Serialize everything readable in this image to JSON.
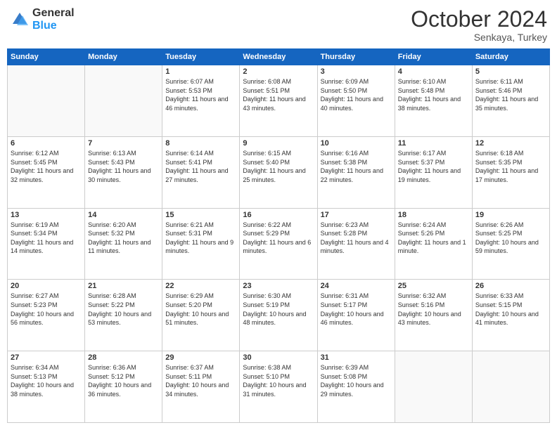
{
  "logo": {
    "general": "General",
    "blue": "Blue"
  },
  "header": {
    "month": "October 2024",
    "location": "Senkaya, Turkey"
  },
  "weekdays": [
    "Sunday",
    "Monday",
    "Tuesday",
    "Wednesday",
    "Thursday",
    "Friday",
    "Saturday"
  ],
  "weeks": [
    [
      {
        "day": "",
        "empty": true
      },
      {
        "day": "",
        "empty": true
      },
      {
        "day": "1",
        "sunrise": "Sunrise: 6:07 AM",
        "sunset": "Sunset: 5:53 PM",
        "daylight": "Daylight: 11 hours and 46 minutes."
      },
      {
        "day": "2",
        "sunrise": "Sunrise: 6:08 AM",
        "sunset": "Sunset: 5:51 PM",
        "daylight": "Daylight: 11 hours and 43 minutes."
      },
      {
        "day": "3",
        "sunrise": "Sunrise: 6:09 AM",
        "sunset": "Sunset: 5:50 PM",
        "daylight": "Daylight: 11 hours and 40 minutes."
      },
      {
        "day": "4",
        "sunrise": "Sunrise: 6:10 AM",
        "sunset": "Sunset: 5:48 PM",
        "daylight": "Daylight: 11 hours and 38 minutes."
      },
      {
        "day": "5",
        "sunrise": "Sunrise: 6:11 AM",
        "sunset": "Sunset: 5:46 PM",
        "daylight": "Daylight: 11 hours and 35 minutes."
      }
    ],
    [
      {
        "day": "6",
        "sunrise": "Sunrise: 6:12 AM",
        "sunset": "Sunset: 5:45 PM",
        "daylight": "Daylight: 11 hours and 32 minutes."
      },
      {
        "day": "7",
        "sunrise": "Sunrise: 6:13 AM",
        "sunset": "Sunset: 5:43 PM",
        "daylight": "Daylight: 11 hours and 30 minutes."
      },
      {
        "day": "8",
        "sunrise": "Sunrise: 6:14 AM",
        "sunset": "Sunset: 5:41 PM",
        "daylight": "Daylight: 11 hours and 27 minutes."
      },
      {
        "day": "9",
        "sunrise": "Sunrise: 6:15 AM",
        "sunset": "Sunset: 5:40 PM",
        "daylight": "Daylight: 11 hours and 25 minutes."
      },
      {
        "day": "10",
        "sunrise": "Sunrise: 6:16 AM",
        "sunset": "Sunset: 5:38 PM",
        "daylight": "Daylight: 11 hours and 22 minutes."
      },
      {
        "day": "11",
        "sunrise": "Sunrise: 6:17 AM",
        "sunset": "Sunset: 5:37 PM",
        "daylight": "Daylight: 11 hours and 19 minutes."
      },
      {
        "day": "12",
        "sunrise": "Sunrise: 6:18 AM",
        "sunset": "Sunset: 5:35 PM",
        "daylight": "Daylight: 11 hours and 17 minutes."
      }
    ],
    [
      {
        "day": "13",
        "sunrise": "Sunrise: 6:19 AM",
        "sunset": "Sunset: 5:34 PM",
        "daylight": "Daylight: 11 hours and 14 minutes."
      },
      {
        "day": "14",
        "sunrise": "Sunrise: 6:20 AM",
        "sunset": "Sunset: 5:32 PM",
        "daylight": "Daylight: 11 hours and 11 minutes."
      },
      {
        "day": "15",
        "sunrise": "Sunrise: 6:21 AM",
        "sunset": "Sunset: 5:31 PM",
        "daylight": "Daylight: 11 hours and 9 minutes."
      },
      {
        "day": "16",
        "sunrise": "Sunrise: 6:22 AM",
        "sunset": "Sunset: 5:29 PM",
        "daylight": "Daylight: 11 hours and 6 minutes."
      },
      {
        "day": "17",
        "sunrise": "Sunrise: 6:23 AM",
        "sunset": "Sunset: 5:28 PM",
        "daylight": "Daylight: 11 hours and 4 minutes."
      },
      {
        "day": "18",
        "sunrise": "Sunrise: 6:24 AM",
        "sunset": "Sunset: 5:26 PM",
        "daylight": "Daylight: 11 hours and 1 minute."
      },
      {
        "day": "19",
        "sunrise": "Sunrise: 6:26 AM",
        "sunset": "Sunset: 5:25 PM",
        "daylight": "Daylight: 10 hours and 59 minutes."
      }
    ],
    [
      {
        "day": "20",
        "sunrise": "Sunrise: 6:27 AM",
        "sunset": "Sunset: 5:23 PM",
        "daylight": "Daylight: 10 hours and 56 minutes."
      },
      {
        "day": "21",
        "sunrise": "Sunrise: 6:28 AM",
        "sunset": "Sunset: 5:22 PM",
        "daylight": "Daylight: 10 hours and 53 minutes."
      },
      {
        "day": "22",
        "sunrise": "Sunrise: 6:29 AM",
        "sunset": "Sunset: 5:20 PM",
        "daylight": "Daylight: 10 hours and 51 minutes."
      },
      {
        "day": "23",
        "sunrise": "Sunrise: 6:30 AM",
        "sunset": "Sunset: 5:19 PM",
        "daylight": "Daylight: 10 hours and 48 minutes."
      },
      {
        "day": "24",
        "sunrise": "Sunrise: 6:31 AM",
        "sunset": "Sunset: 5:17 PM",
        "daylight": "Daylight: 10 hours and 46 minutes."
      },
      {
        "day": "25",
        "sunrise": "Sunrise: 6:32 AM",
        "sunset": "Sunset: 5:16 PM",
        "daylight": "Daylight: 10 hours and 43 minutes."
      },
      {
        "day": "26",
        "sunrise": "Sunrise: 6:33 AM",
        "sunset": "Sunset: 5:15 PM",
        "daylight": "Daylight: 10 hours and 41 minutes."
      }
    ],
    [
      {
        "day": "27",
        "sunrise": "Sunrise: 6:34 AM",
        "sunset": "Sunset: 5:13 PM",
        "daylight": "Daylight: 10 hours and 38 minutes."
      },
      {
        "day": "28",
        "sunrise": "Sunrise: 6:36 AM",
        "sunset": "Sunset: 5:12 PM",
        "daylight": "Daylight: 10 hours and 36 minutes."
      },
      {
        "day": "29",
        "sunrise": "Sunrise: 6:37 AM",
        "sunset": "Sunset: 5:11 PM",
        "daylight": "Daylight: 10 hours and 34 minutes."
      },
      {
        "day": "30",
        "sunrise": "Sunrise: 6:38 AM",
        "sunset": "Sunset: 5:10 PM",
        "daylight": "Daylight: 10 hours and 31 minutes."
      },
      {
        "day": "31",
        "sunrise": "Sunrise: 6:39 AM",
        "sunset": "Sunset: 5:08 PM",
        "daylight": "Daylight: 10 hours and 29 minutes."
      },
      {
        "day": "",
        "empty": true
      },
      {
        "day": "",
        "empty": true
      }
    ]
  ]
}
